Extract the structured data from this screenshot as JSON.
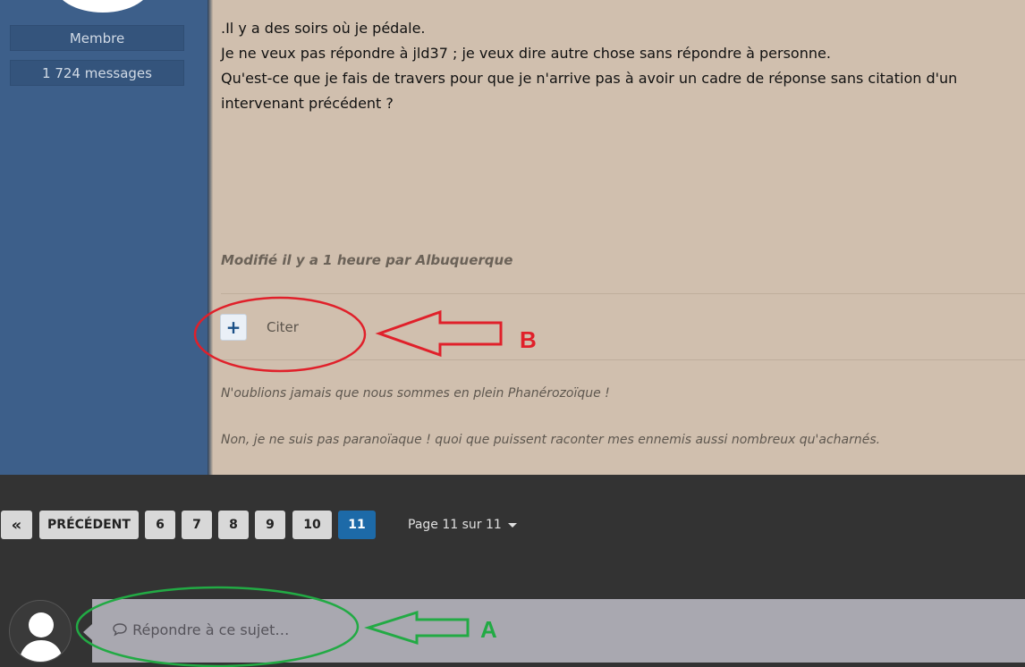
{
  "sidebar": {
    "role": "Membre",
    "message_count": "1 724 messages"
  },
  "post": {
    "lines": [
      ".Il y a des soirs où je pédale.",
      "Je ne veux pas répondre à jld37 ; je veux dire autre chose sans répondre à personne.",
      "Qu'est-ce que je fais de travers pour que je n'arrive pas à avoir un cadre de réponse sans citation d'un intervenant précédent ?"
    ],
    "modified": "Modifié il y a 1 heure par Albuquerque",
    "quote_button_symbol": "+",
    "quote_label": "Citer",
    "signature": [
      "N'oublions jamais que nous sommes en plein Phanérozoïque !",
      "Non, je ne suis pas paranoïaque ! quoi que puissent raconter mes ennemis aussi nombreux qu'acharnés."
    ]
  },
  "pagination": {
    "first_label": "«",
    "previous_label": "PRÉCÉDENT",
    "pages": [
      "6",
      "7",
      "8",
      "9",
      "10",
      "11"
    ],
    "current_page": "11",
    "page_info": "Page 11 sur 11"
  },
  "reply": {
    "placeholder": "Répondre à ce sujet…"
  },
  "annotations": {
    "a_label": "A",
    "b_label": "B",
    "a_color": "#22aa44",
    "b_color": "#e0202a"
  },
  "colors": {
    "sidebar": "#3d5f8a",
    "post_background": "#d0bfae",
    "page_background": "#333333",
    "active_page": "#1d6aa8"
  }
}
